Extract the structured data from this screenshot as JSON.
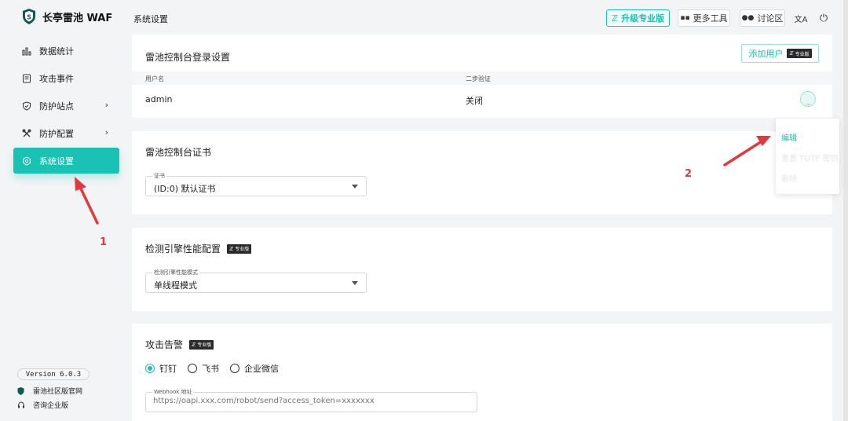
{
  "app": {
    "name": "长亭雷池 WAF",
    "page_title": "系统设置"
  },
  "sidebar": {
    "items": [
      {
        "label": "数据统计",
        "icon": "bar-chart-icon"
      },
      {
        "label": "攻击事件",
        "icon": "document-icon"
      },
      {
        "label": "防护站点",
        "icon": "shield-icon",
        "chevron": "›"
      },
      {
        "label": "防护配置",
        "icon": "tools-icon",
        "chevron": "›"
      },
      {
        "label": "系统设置",
        "icon": "gear-icon",
        "active": true
      }
    ],
    "version": "Version 6.0.3",
    "links": [
      {
        "label": "雷池社区版官网",
        "icon": "shield-small-icon"
      },
      {
        "label": "咨询企业版",
        "icon": "headset-icon"
      }
    ]
  },
  "header": {
    "upgrade_label": "升级专业版",
    "more_tools_label": "更多工具",
    "forum_label": "讨论区",
    "language_icon": "translate-icon",
    "logout_icon": "logout-icon"
  },
  "pro_tag": "专业版",
  "login_settings": {
    "title": "雷池控制台登录设置",
    "add_user_label": "添加用户",
    "columns": [
      "用户名",
      "二步验证"
    ],
    "rows": [
      {
        "username": "admin",
        "two_step": "关闭"
      }
    ]
  },
  "popup_menu": {
    "items": [
      {
        "label": "编辑",
        "active": true
      },
      {
        "label": "重置 TOTP 密钥",
        "active": false
      },
      {
        "label": "删除",
        "active": false
      }
    ]
  },
  "certificate": {
    "title": "雷池控制台证书",
    "field_label": "证书",
    "value": "(ID:0) 默认证书"
  },
  "engine": {
    "title": "检测引擎性能配置",
    "field_label": "检测引擎性能模式",
    "value": "单线程模式"
  },
  "alert": {
    "title": "攻击告警",
    "options": [
      {
        "label": "钉钉",
        "checked": true
      },
      {
        "label": "飞书",
        "checked": false
      },
      {
        "label": "企业微信",
        "checked": false
      }
    ],
    "webhook_label": "Webhook 地址",
    "webhook_placeholder": "https://oapi.xxx.com/robot/send?access_token=xxxxxxx"
  },
  "annotations": [
    "1",
    "2"
  ],
  "colors": {
    "accent": "#19c2b3",
    "annotation": "#e0393e"
  }
}
